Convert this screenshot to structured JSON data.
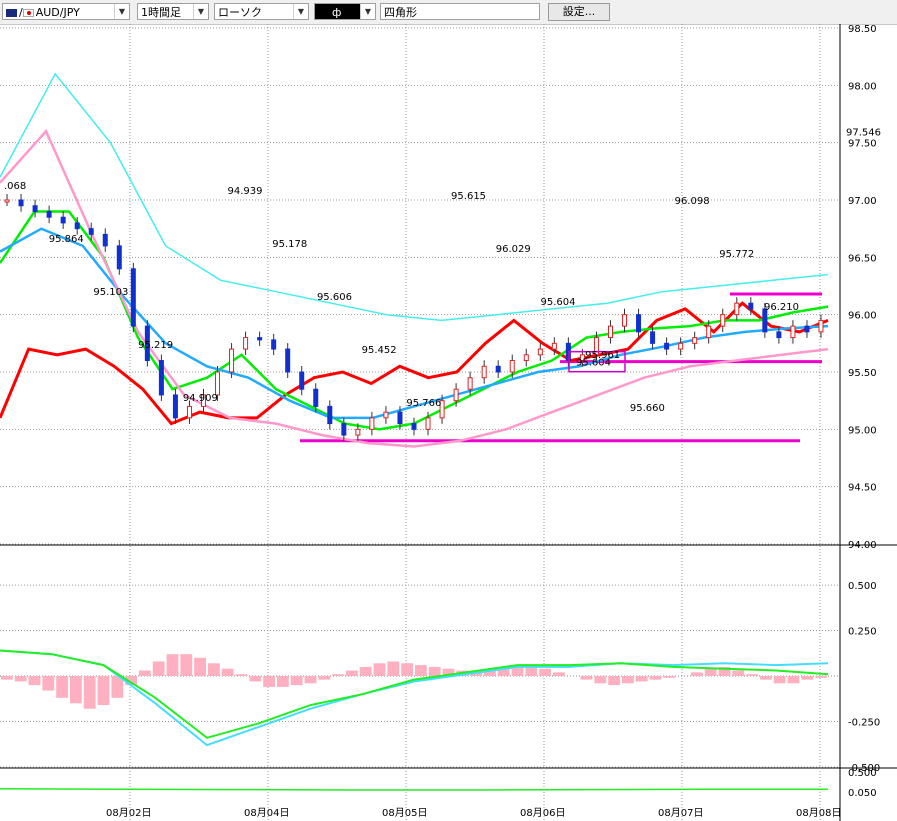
{
  "toolbar": {
    "symbol": "AUD/JPY",
    "timeframe": "1時間足",
    "chart_style": "ローソク",
    "drawing_tool_symbol": "ф",
    "drawing_shape": "四角形",
    "settings_label": "設定..."
  },
  "chart_data": [
    {
      "type": "line",
      "title": "",
      "price_axis_ticks": [
        "98.50",
        "98.00",
        "97.50",
        "97.00",
        "96.50",
        "96.00",
        "95.50",
        "95.00",
        "94.50",
        "94.00"
      ],
      "current_price_label": "97.546",
      "x_axis_labels": [
        "08月02日",
        "08月04日",
        "08月05日",
        "08月06日",
        "08月07日",
        "08月08日"
      ],
      "ylim": [
        94.0,
        98.5
      ],
      "grid": true,
      "price_annotations": [
        ".068",
        "95.864",
        "95.103",
        "95.219",
        "94.909",
        "94.939",
        "95.178",
        "95.606",
        "95.452",
        "95.766",
        "95.615",
        "96.029",
        "95.604",
        "95.961",
        "95.660",
        "96.098",
        "95.772",
        "96.210"
      ],
      "horizontal_lines": [
        96.18,
        95.59,
        94.9
      ],
      "highlighted_box_label": "95.604",
      "candles_close": [
        97.0,
        96.95,
        96.9,
        96.85,
        96.8,
        96.75,
        96.7,
        96.6,
        96.4,
        95.9,
        95.6,
        95.3,
        95.1,
        95.2,
        95.3,
        95.5,
        95.7,
        95.8,
        95.78,
        95.7,
        95.5,
        95.35,
        95.2,
        95.05,
        94.95,
        95.0,
        95.1,
        95.15,
        95.05,
        95.0,
        95.1,
        95.25,
        95.35,
        95.45,
        95.55,
        95.5,
        95.6,
        95.65,
        95.7,
        95.75,
        95.6,
        95.65,
        95.8,
        95.9,
        96.0,
        95.85,
        95.75,
        95.7,
        95.75,
        95.8,
        95.9,
        96.0,
        96.1,
        96.05,
        95.85,
        95.8,
        95.9,
        95.85,
        95.95
      ],
      "series": [
        {
          "name": "",
          "color": "#ff0000",
          "values": [
            95.1,
            95.7,
            95.65,
            95.7,
            95.55,
            95.35,
            95.05,
            95.15,
            95.1,
            95.1,
            95.3,
            95.45,
            95.5,
            95.4,
            95.55,
            95.45,
            95.5,
            95.75,
            95.95,
            95.75,
            95.6,
            95.65,
            95.7,
            95.95,
            96.05,
            95.85,
            96.1,
            95.9,
            95.85,
            95.95
          ]
        },
        {
          "name": "",
          "color": "#00ee00",
          "values": [
            96.45,
            96.9,
            96.9,
            96.5,
            95.8,
            95.35,
            95.45,
            95.65,
            95.35,
            95.2,
            95.05,
            95.0,
            95.05,
            95.2,
            95.35,
            95.5,
            95.6,
            95.8,
            95.85,
            95.88,
            95.9,
            95.95,
            95.95,
            96.02,
            96.07
          ]
        },
        {
          "name": "",
          "color": "#22aaff",
          "values": [
            96.55,
            96.75,
            96.6,
            96.15,
            95.75,
            95.55,
            95.45,
            95.25,
            95.1,
            95.1,
            95.2,
            95.3,
            95.4,
            95.5,
            95.55,
            95.65,
            95.72,
            95.8,
            95.85,
            95.88,
            95.9
          ]
        },
        {
          "name": "",
          "color": "#ff99cc",
          "values": [
            97.15,
            97.6,
            96.7,
            95.85,
            95.3,
            95.1,
            95.05,
            94.95,
            94.88,
            94.85,
            94.9,
            95.0,
            95.15,
            95.3,
            95.45,
            95.55,
            95.6,
            95.65,
            95.7
          ]
        },
        {
          "name": "",
          "color": "#44eeee",
          "values": [
            97.2,
            98.1,
            97.5,
            96.6,
            96.3,
            96.2,
            96.1,
            96.0,
            95.95,
            96.0,
            96.05,
            96.1,
            96.2,
            96.25,
            96.3,
            96.35
          ]
        }
      ]
    },
    {
      "type": "line",
      "title": "",
      "axis_ticks": [
        "0.500",
        "0.250",
        "-0.250",
        "-0.500"
      ],
      "ylim": [
        -0.55,
        0.55
      ],
      "histogram_color": "#ffb0c0",
      "histogram": [
        -0.02,
        -0.03,
        -0.05,
        -0.08,
        -0.12,
        -0.15,
        -0.18,
        -0.16,
        -0.12,
        -0.05,
        0.03,
        0.08,
        0.12,
        0.12,
        0.1,
        0.07,
        0.04,
        0.01,
        -0.03,
        -0.06,
        -0.06,
        -0.05,
        -0.04,
        -0.02,
        0.01,
        0.03,
        0.05,
        0.07,
        0.08,
        0.07,
        0.06,
        0.05,
        0.04,
        0.03,
        0.02,
        0.03,
        0.04,
        0.05,
        0.05,
        0.04,
        0.02,
        0.0,
        -0.02,
        -0.04,
        -0.05,
        -0.04,
        -0.03,
        -0.02,
        -0.01,
        0.0,
        0.02,
        0.04,
        0.05,
        0.03,
        0.01,
        -0.02,
        -0.04,
        -0.04,
        -0.02,
        -0.01
      ],
      "series": [
        {
          "name": "",
          "color": "#44ddff",
          "values": [
            0.14,
            0.12,
            0.06,
            -0.15,
            -0.38,
            -0.28,
            -0.18,
            -0.1,
            -0.03,
            0.01,
            0.05,
            0.05,
            0.07,
            0.06,
            0.07,
            0.06,
            0.07
          ]
        },
        {
          "name": "",
          "color": "#22ee22",
          "values": [
            0.14,
            0.12,
            0.06,
            -0.12,
            -0.34,
            -0.26,
            -0.16,
            -0.1,
            -0.02,
            0.02,
            0.06,
            0.06,
            0.07,
            0.05,
            0.04,
            0.03,
            0.01
          ]
        }
      ]
    },
    {
      "type": "line",
      "title": "",
      "axis_ticks": [
        "0.500",
        "0.050"
      ],
      "series": [
        {
          "name": "",
          "color": "#22ee22",
          "values": [
            0.08,
            0.07,
            0.06,
            0.05,
            0.05,
            0.06,
            0.07,
            0.07
          ]
        }
      ]
    }
  ]
}
